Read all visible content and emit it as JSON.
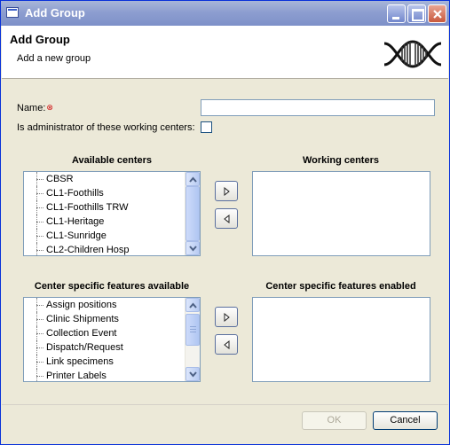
{
  "window": {
    "title": "Add Group"
  },
  "header": {
    "title": "Add Group",
    "subtitle": "Add a new group"
  },
  "form": {
    "name_label": "Name:",
    "name_value": "",
    "required_marker": "⊗",
    "admin_label": "Is administrator of these working centers:",
    "admin_checked": false
  },
  "centers": {
    "available_title": "Available centers",
    "working_title": "Working centers",
    "available": [
      "CBSR",
      "CL1-Foothills",
      "CL1-Foothills TRW",
      "CL1-Heritage",
      "CL1-Sunridge",
      "CL2-Children Hosp"
    ],
    "working": []
  },
  "features": {
    "available_title": "Center specific features available",
    "enabled_title": "Center specific features enabled",
    "available": [
      "Assign positions",
      "Clinic Shipments",
      "Collection Event",
      "Dispatch/Request",
      "Link specimens",
      "Printer Labels"
    ],
    "enabled": []
  },
  "buttons": {
    "ok": "OK",
    "cancel": "Cancel",
    "ok_enabled": false
  },
  "icons": {
    "title": "window-icon",
    "logo": "dna-helix-icon",
    "move_right": "arrow-right-icon",
    "move_left": "arrow-left-icon"
  }
}
